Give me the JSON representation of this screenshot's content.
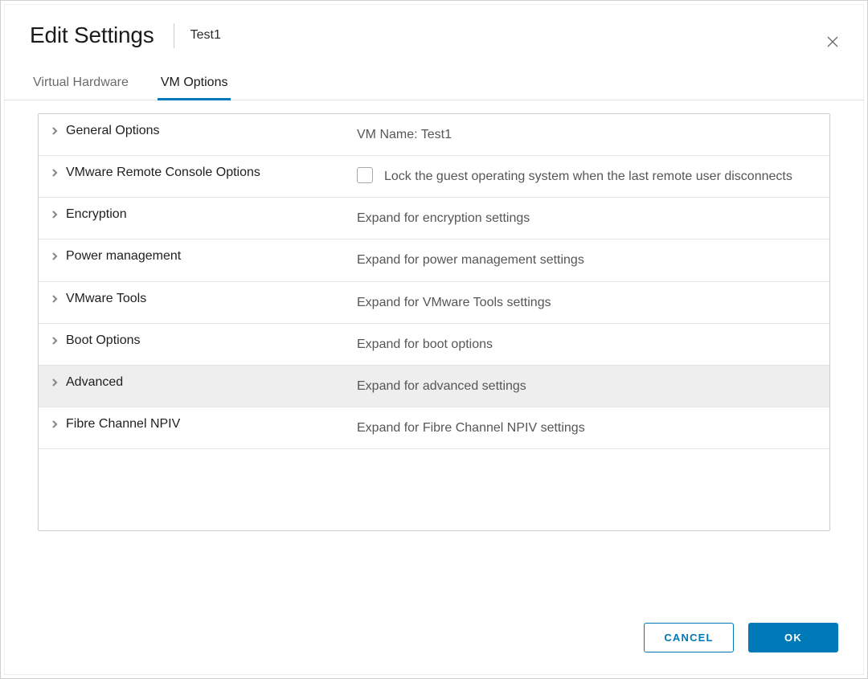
{
  "header": {
    "title": "Edit Settings",
    "subtitle": "Test1"
  },
  "tabs": {
    "virtual_hardware": "Virtual Hardware",
    "vm_options": "VM Options",
    "active": "vm_options"
  },
  "rows": {
    "general": {
      "label": "General Options",
      "value": "VM Name: Test1"
    },
    "remote_console": {
      "label": "VMware Remote Console Options",
      "value": "Lock the guest operating system when the last remote user disconnects"
    },
    "encryption": {
      "label": "Encryption",
      "value": "Expand for encryption settings"
    },
    "power": {
      "label": "Power management",
      "value": "Expand for power management settings"
    },
    "tools": {
      "label": "VMware Tools",
      "value": "Expand for VMware Tools settings"
    },
    "boot": {
      "label": "Boot Options",
      "value": "Expand for boot options"
    },
    "advanced": {
      "label": "Advanced",
      "value": "Expand for advanced settings"
    },
    "npiv": {
      "label": "Fibre Channel NPIV",
      "value": "Expand for Fibre Channel NPIV settings"
    }
  },
  "footer": {
    "cancel": "CANCEL",
    "ok": "OK"
  }
}
